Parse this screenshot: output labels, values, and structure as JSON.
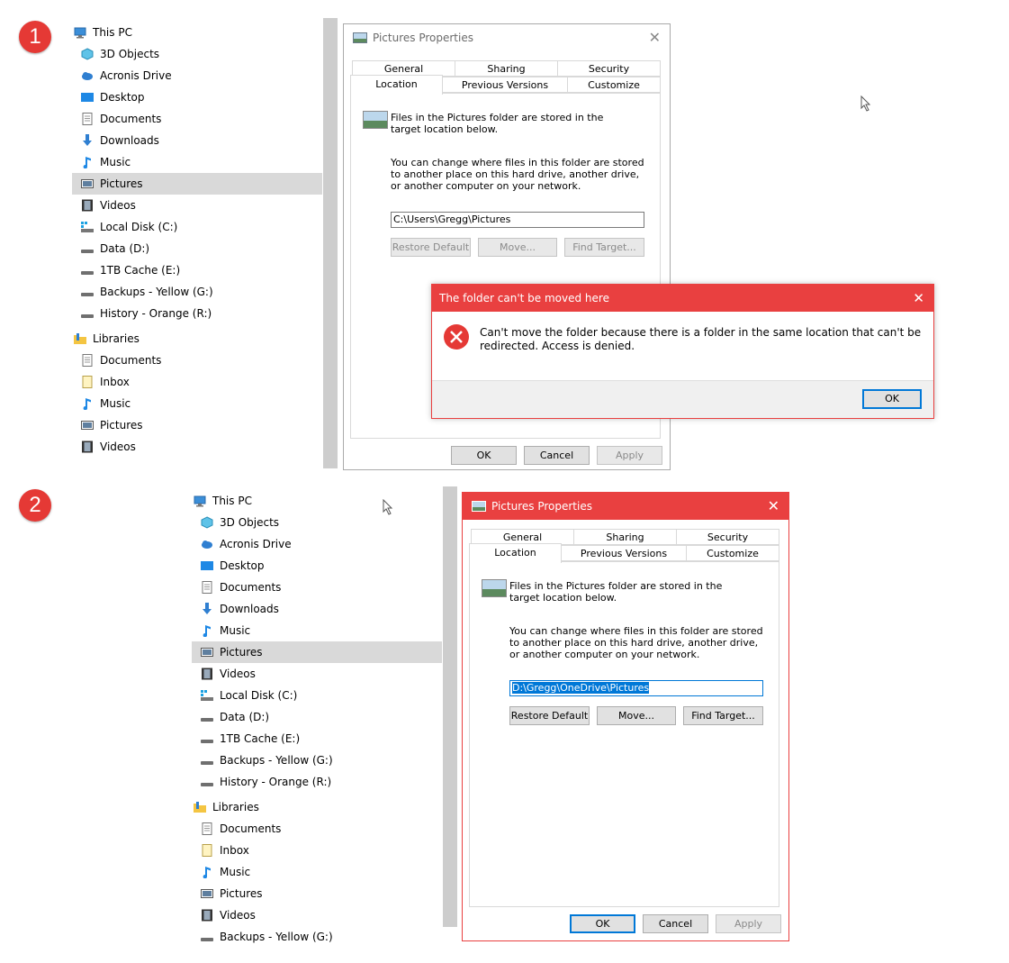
{
  "step1": {
    "badge": "1",
    "nav": {
      "this_pc": "This PC",
      "items": [
        {
          "label": "3D Objects",
          "icon": "3d-objects-icon"
        },
        {
          "label": "Acronis Drive",
          "icon": "acronis-drive-icon"
        },
        {
          "label": "Desktop",
          "icon": "desktop-icon"
        },
        {
          "label": "Documents",
          "icon": "documents-icon"
        },
        {
          "label": "Downloads",
          "icon": "downloads-icon"
        },
        {
          "label": "Music",
          "icon": "music-icon"
        },
        {
          "label": "Pictures",
          "icon": "pictures-icon"
        },
        {
          "label": "Videos",
          "icon": "videos-icon"
        },
        {
          "label": "Local Disk (C:)",
          "icon": "local-disk-icon"
        },
        {
          "label": "Data (D:)",
          "icon": "drive-icon"
        },
        {
          "label": "1TB Cache (E:)",
          "icon": "drive-icon"
        },
        {
          "label": "Backups - Yellow (G:)",
          "icon": "drive-icon"
        },
        {
          "label": "History - Orange (R:)",
          "icon": "drive-icon"
        }
      ],
      "libraries": "Libraries",
      "lib_items": [
        {
          "label": "Documents",
          "icon": "documents-icon"
        },
        {
          "label": "Inbox",
          "icon": "inbox-icon"
        },
        {
          "label": "Music",
          "icon": "music-icon"
        },
        {
          "label": "Pictures",
          "icon": "pictures-icon"
        },
        {
          "label": "Videos",
          "icon": "videos-icon"
        }
      ],
      "selected": "Pictures"
    },
    "dialog": {
      "title": "Pictures Properties",
      "tabs_row1": [
        "General",
        "Sharing",
        "Security"
      ],
      "tabs_row2": [
        "Location",
        "Previous Versions",
        "Customize"
      ],
      "active_tab": "Location",
      "intro": "Files in the Pictures folder are stored in the target location below.",
      "info": "You can change where files in this folder are stored to another place on this hard drive, another drive, or another computer on your network.",
      "path": "C:\\Users\\Gregg\\Pictures",
      "restore_default": "Restore Default",
      "move": "Move...",
      "find_target": "Find Target...",
      "ok": "OK",
      "cancel": "Cancel",
      "apply": "Apply"
    },
    "error": {
      "title": "The folder can't be moved here",
      "message": "Can't move the folder because there is a folder in the same location that can't be redirected. Access is denied.",
      "ok": "OK",
      "accent": "#e94040"
    }
  },
  "step2": {
    "badge": "2",
    "dialog": {
      "title": "Pictures Properties",
      "path": "D:\\Gregg\\OneDrive\\Pictures",
      "accent": "#e94040"
    },
    "partial_item": "Backups - Yellow (G:)"
  }
}
